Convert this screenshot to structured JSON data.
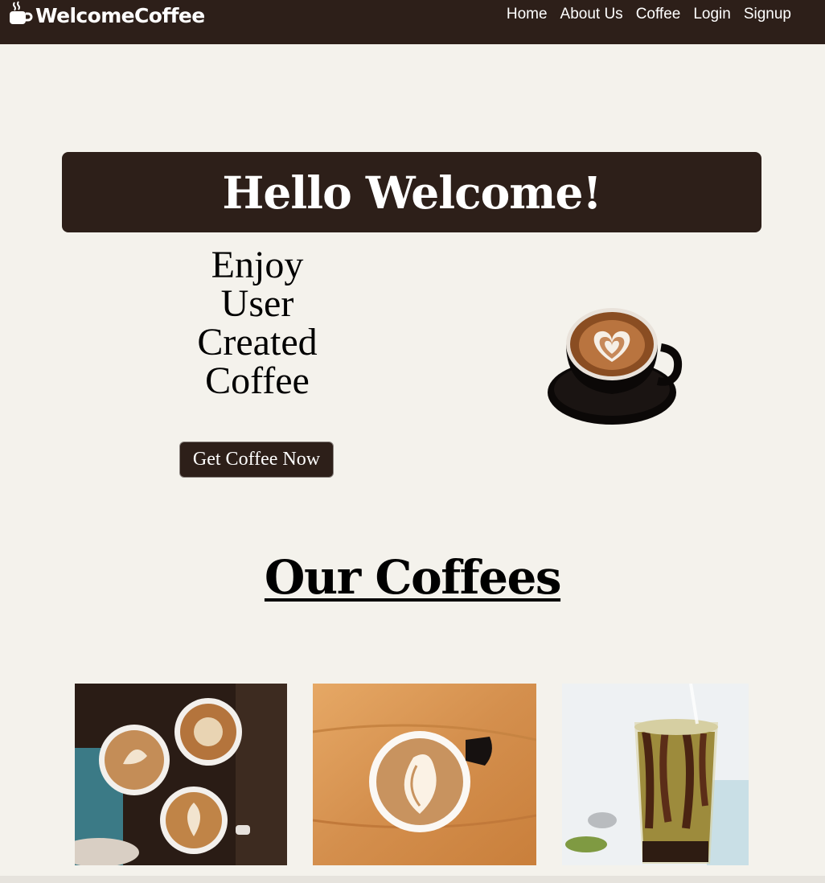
{
  "navbar": {
    "brand": "WelcomeCoffee",
    "links": [
      "Home",
      "About Us",
      "Coffee",
      "Login",
      "Signup"
    ]
  },
  "hero": {
    "title": "Hello Welcome!",
    "tagline_lines": [
      "Enjoy",
      "User",
      "Created",
      "Coffee"
    ],
    "cta_label": "Get Coffee Now"
  },
  "coffees": {
    "heading": "Our Coffees",
    "cards": [
      {
        "image": "latte-art-table-image"
      },
      {
        "image": "latte-art-cup-image"
      },
      {
        "image": "matcha-iced-drink-image"
      }
    ]
  },
  "colors": {
    "brand_dark": "#2d1f19",
    "page_background": "#f4f2ec",
    "text_light": "#ffffff"
  },
  "icons": {
    "brand_icon": "coffee-cup-icon"
  }
}
